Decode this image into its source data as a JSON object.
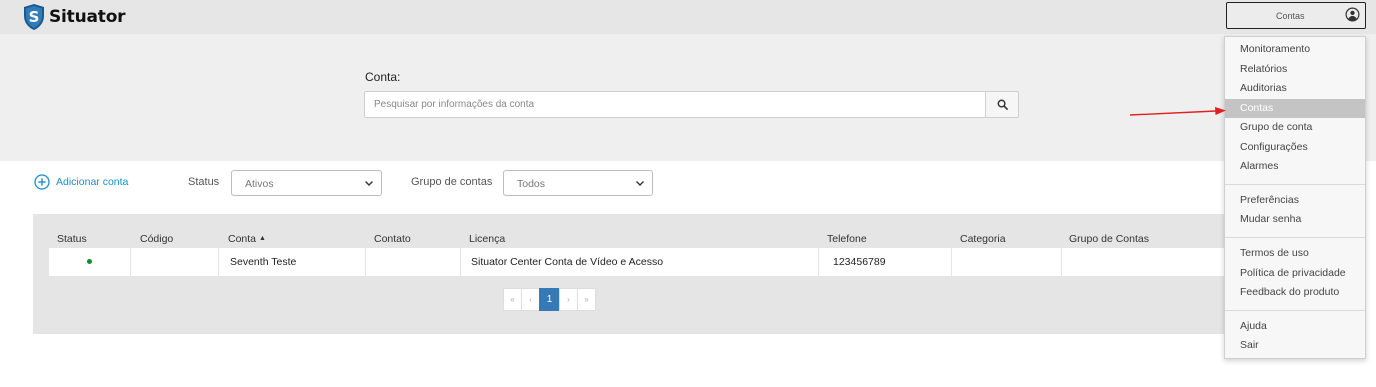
{
  "app": {
    "name": "Situator",
    "logo_letter": "S"
  },
  "header": {
    "account_button_label": "Contas"
  },
  "search": {
    "label": "Conta:",
    "placeholder": "Pesquisar por informações da conta"
  },
  "toolbar": {
    "add_account_label": "Adicionar conta",
    "status_label": "Status",
    "status_value": "Ativos",
    "group_label": "Grupo de contas",
    "group_value": "Todos"
  },
  "table": {
    "columns": [
      "Status",
      "Código",
      "Conta",
      "Contato",
      "Licença",
      "Telefone",
      "Categoria",
      "Grupo de Contas"
    ],
    "sort_indicator": "▲",
    "rows": [
      {
        "status": "active",
        "codigo": "",
        "conta": "Seventh Teste",
        "contato": "",
        "licenca": "Situator Center Conta de Vídeo e Acesso",
        "telefone": "123456789",
        "categoria": "",
        "grupo": ""
      }
    ]
  },
  "pagination": {
    "first": "«",
    "prev": "‹",
    "current": "1",
    "next": "›",
    "last": "»"
  },
  "menu": {
    "items": [
      {
        "label": "Monitoramento"
      },
      {
        "label": "Relatórios"
      },
      {
        "label": "Auditorias"
      },
      {
        "label": "Contas",
        "active": true
      },
      {
        "label": "Grupo de conta"
      },
      {
        "label": "Configurações"
      },
      {
        "label": "Alarmes"
      },
      {
        "label": "Preferências"
      },
      {
        "label": "Mudar senha"
      },
      {
        "label": "Termos de uso"
      },
      {
        "label": "Política de privacidade"
      },
      {
        "label": "Feedback do produto"
      },
      {
        "label": "Ajuda"
      },
      {
        "label": "Sair"
      }
    ]
  },
  "colors": {
    "accent": "#1b8fc7",
    "pager_active": "#337ab7",
    "status_active": "#1a8a2a",
    "annotation_arrow": "#e02020",
    "logo": "#1c5a8c"
  }
}
